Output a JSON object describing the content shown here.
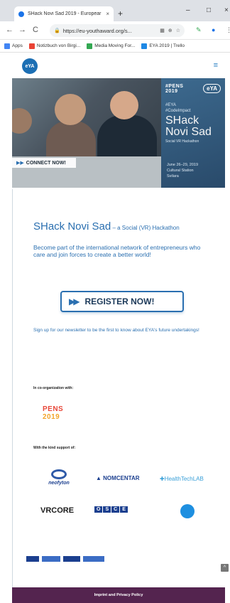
{
  "browser": {
    "tab_title": "SHack Novi Sad 2019 - Europear",
    "tab_close": "×",
    "new_tab": "+",
    "url": "https://eu-youthaward.org/s...",
    "window_minimize": "–",
    "window_maximize": "□",
    "window_close": "×",
    "back": "←",
    "forward": "→",
    "reload": "C",
    "bookmarks": [
      {
        "label": "Apps",
        "color": "#4285f4"
      },
      {
        "label": "Notizbuch von Birgi...",
        "color": "#ea4335"
      },
      {
        "label": "Media Moving For...",
        "color": "#34a853"
      },
      {
        "label": "EYA 2019 | Trello",
        "color": "#1e88e5"
      }
    ]
  },
  "site": {
    "logo_text": "eYA",
    "menu_icon": "≡",
    "hero": {
      "pens": "#PENS\n2019",
      "eya": "eYA",
      "hashtags": "#EYA\n#CodeImpact",
      "title_line1": "SHack",
      "title_line2": "Novi Sad",
      "subtitle": "Social VR Hackathon",
      "date": "June 26–29, 2019",
      "venue": "Cultural Station\nSvilara",
      "connect": "CONNECT NOW!"
    },
    "main_title": "SHack Novi Sad",
    "main_subtitle": " – a Social (VR) Hackathon",
    "tagline": "Become part of the international network of entrepreneurs who care and join forces to create a better world!",
    "register_label": "REGISTER NOW!",
    "newsletter": "Sign up for our newsletter to be the first to know about EYA's future undertakings!",
    "coorg_label": "In co-organization with:",
    "pens_row1": "PENS",
    "pens_row2": "2019",
    "support_label": "With the kind support of:",
    "partners": {
      "neofyton": "neofyton",
      "nomcentar": "NOMCENTAR",
      "healthtech": "HealthTechLAB",
      "vrcore": "VRCORE",
      "osce": "OSCE"
    },
    "scroll_top": "^",
    "footer": "Imprint and Privacy Policy"
  }
}
